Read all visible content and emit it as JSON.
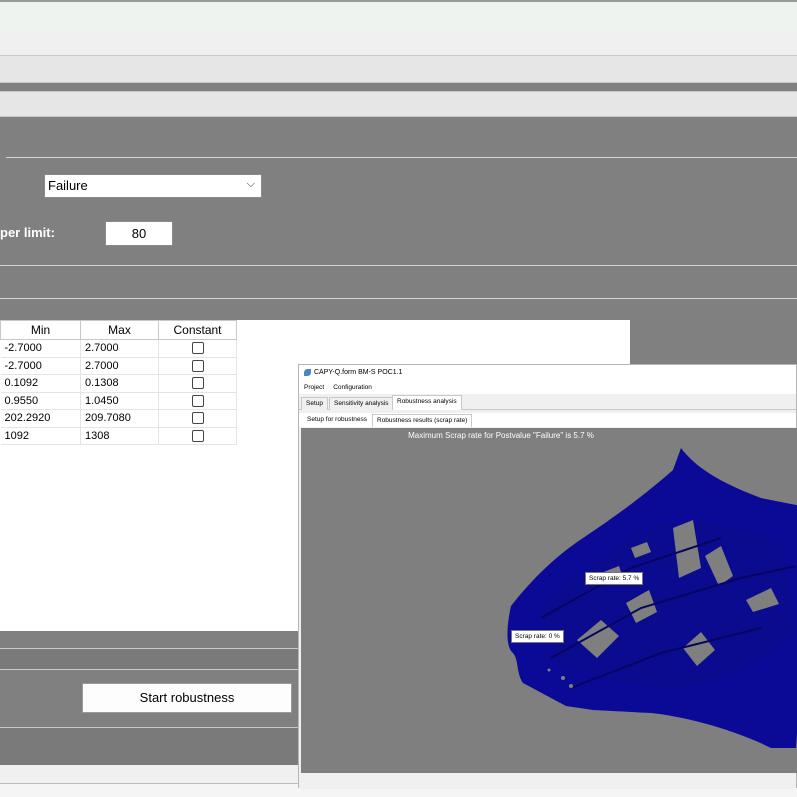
{
  "postvalue_select": {
    "value": "Failure"
  },
  "upper_limit": {
    "label": "per limit:",
    "value": "80"
  },
  "table": {
    "headers": [
      "Min",
      "Max",
      "Constant"
    ],
    "rows": [
      {
        "min": "-2.7000",
        "max": "2.7000",
        "constant": false
      },
      {
        "min": "-2.7000",
        "max": "2.7000",
        "constant": false
      },
      {
        "min": "0.1092",
        "max": "0.1308",
        "constant": false
      },
      {
        "min": "0.9550",
        "max": "1.0450",
        "constant": false
      },
      {
        "min": "202.2920",
        "max": "209.7080",
        "constant": false
      },
      {
        "min": "1092",
        "max": "1308",
        "constant": false
      }
    ]
  },
  "start_button": {
    "label": "Start robustness"
  },
  "capy_window": {
    "title": "CAPY-Q.form BM-S POC1.1",
    "menu": [
      "Project",
      "Configuration"
    ],
    "main_tabs": [
      "Setup",
      "Sensitivity analysis",
      "Robustness analysis"
    ],
    "active_main_tab": "Robustness analysis",
    "sub_tabs": [
      "Setup for robustness",
      "Robustness results (scrap rate)"
    ],
    "active_sub_tab": "Robustness results (scrap rate)",
    "viewport_title": "Maximum Scrap rate for Postvalue \"Failure\" is 5.7 %",
    "tooltips": [
      "Scrap rate: 5.7 %",
      "Scrap rate: 0 %"
    ],
    "part_color": "#0a0a96"
  },
  "colors": {
    "panel_gray": "#808080",
    "part_blue": "#0a0a96"
  }
}
